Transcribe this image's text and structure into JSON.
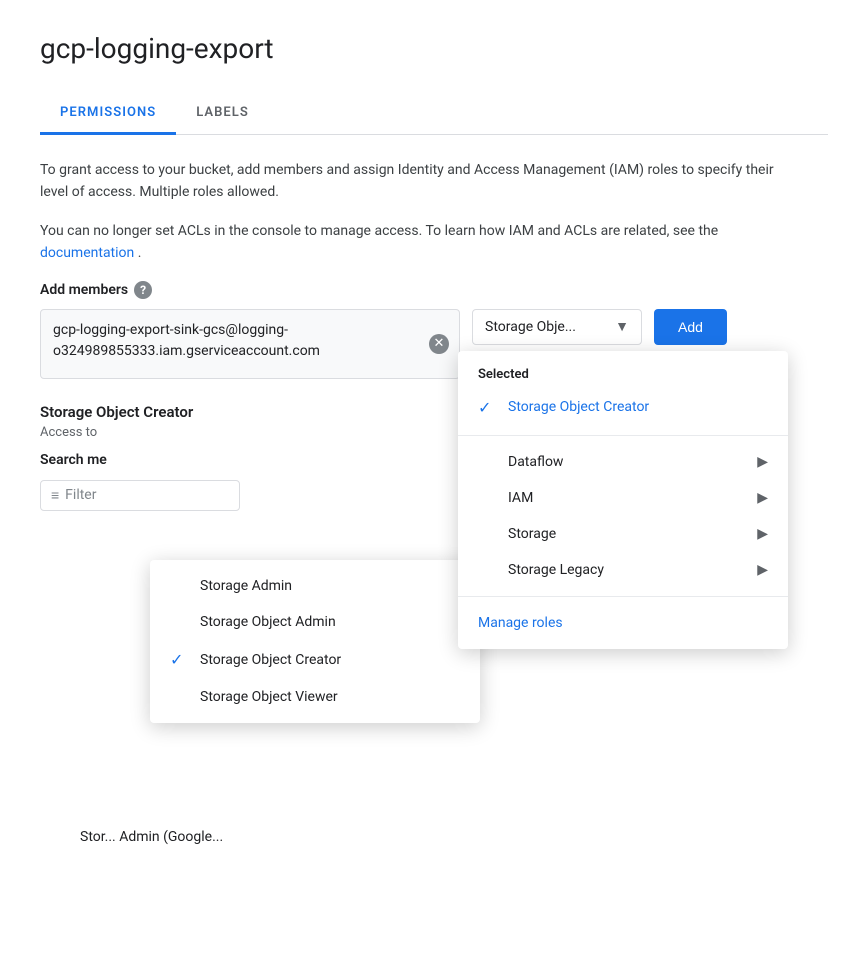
{
  "page": {
    "title": "gcp-logging-export"
  },
  "tabs": [
    {
      "id": "permissions",
      "label": "PERMISSIONS",
      "active": true
    },
    {
      "id": "labels",
      "label": "LABELS",
      "active": false
    }
  ],
  "description": {
    "line1": "To grant access to your bucket, add members and assign Identity and Access Management (IAM) roles to specify their level of access. Multiple roles allowed.",
    "line2": "You can no longer set ACLs in the console to manage access. To learn how IAM and ACLs are related, see the ",
    "link_text": "documentation",
    "line2_end": "."
  },
  "add_members": {
    "label": "Add members",
    "help_tooltip": "?",
    "member_value": "gcp-logging-export-sink-gcs@logging-o324989855333.iam.gserviceaccount.com",
    "role_display": "Storage Obje...",
    "add_button_label": "Add"
  },
  "role_dropdown": {
    "section_selected_label": "Selected",
    "selected_role": "Storage Object Creator",
    "categories": [
      {
        "id": "dataflow",
        "label": "Dataflow",
        "has_submenu": true
      },
      {
        "id": "iam",
        "label": "IAM",
        "has_submenu": true
      },
      {
        "id": "storage",
        "label": "Storage",
        "has_submenu": true
      },
      {
        "id": "storage-legacy",
        "label": "Storage Legacy",
        "has_submenu": true
      }
    ],
    "manage_roles_label": "Manage roles"
  },
  "left_dropdown": {
    "items": [
      {
        "id": "storage-admin",
        "label": "Storage Admin",
        "checked": false
      },
      {
        "id": "storage-object-admin",
        "label": "Storage Object Admin",
        "checked": false
      },
      {
        "id": "storage-object-creator",
        "label": "Storage Object Creator",
        "checked": true
      },
      {
        "id": "storage-object-viewer",
        "label": "Storage Object Viewer",
        "checked": false
      }
    ]
  },
  "storage_object_section": {
    "title": "Storage Object Creator",
    "desc": "Access to",
    "search_placeholder": "Filter",
    "bottom_item": "Stor... Admin (Google..."
  },
  "icons": {
    "filter": "≡",
    "chevron_right": "▶",
    "chevron_down": "▼",
    "check": "✓",
    "close": "✕"
  }
}
